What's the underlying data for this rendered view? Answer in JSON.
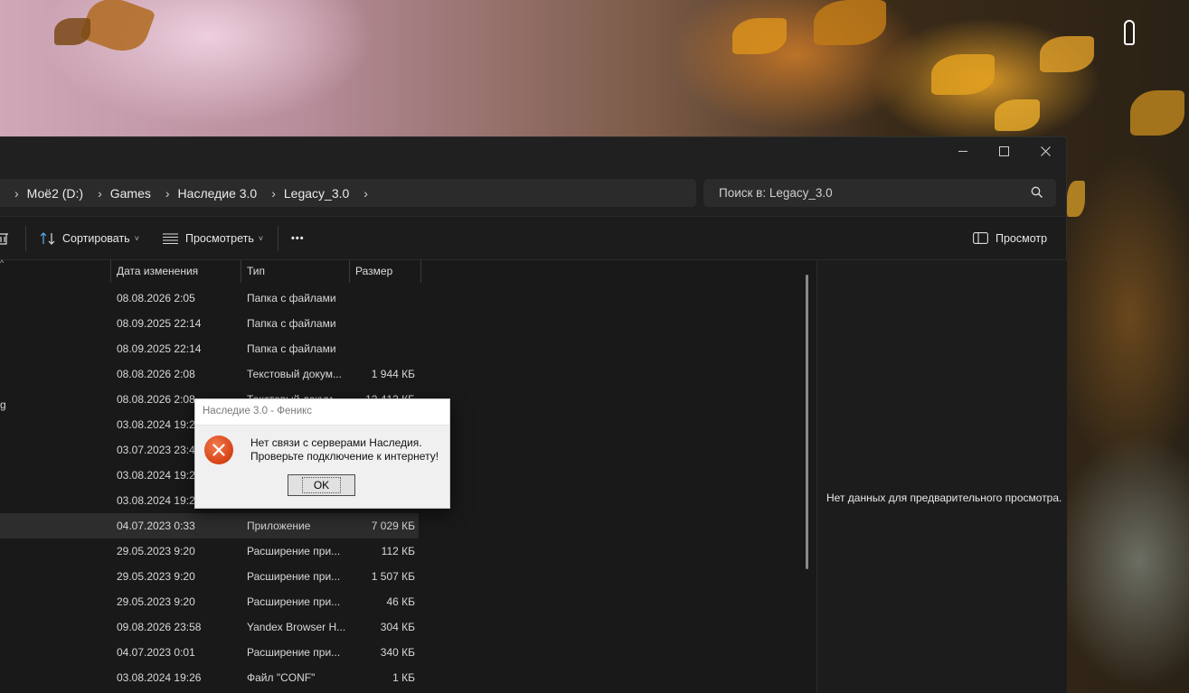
{
  "window": {
    "breadcrumbs": [
      "Моё2 (D:)",
      "Games",
      "Наследие 3.0",
      "Legacy_3.0"
    ],
    "search_placeholder": "Поиск в: Legacy_3.0"
  },
  "toolbar": {
    "sort_label": "Сортировать",
    "view_label": "Просмотреть",
    "more_label": "•••",
    "preview_label": "Просмотр"
  },
  "columns": {
    "date": "Дата изменения",
    "type": "Тип",
    "size": "Размер"
  },
  "rows": [
    {
      "date": "08.08.2026 2:05",
      "type": "Папка с файлами",
      "size": ""
    },
    {
      "date": "08.09.2025 22:14",
      "type": "Папка с файлами",
      "size": ""
    },
    {
      "date": "08.09.2025 22:14",
      "type": "Папка с файлами",
      "size": ""
    },
    {
      "date": "08.08.2026 2:08",
      "type": "Текстовый докум...",
      "size": "1 944 КБ"
    },
    {
      "date": "08.08.2026 2:08",
      "type": "Текстовый докум...",
      "size": "12 413 КБ"
    },
    {
      "date": "03.08.2024 19:26",
      "type": "",
      "size": ""
    },
    {
      "date": "03.07.2023 23:43",
      "type": "",
      "size": ""
    },
    {
      "date": "03.08.2024 19:26",
      "type": "",
      "size": ""
    },
    {
      "date": "03.08.2024 19:26",
      "type": "",
      "size": ""
    },
    {
      "date": "04.07.2023 0:33",
      "type": "Приложение",
      "size": "7 029 КБ"
    },
    {
      "date": "29.05.2023 9:20",
      "type": "Расширение при...",
      "size": "112 КБ"
    },
    {
      "date": "29.05.2023 9:20",
      "type": "Расширение при...",
      "size": "1 507 КБ"
    },
    {
      "date": "29.05.2023 9:20",
      "type": "Расширение при...",
      "size": "46 КБ"
    },
    {
      "date": "09.08.2026 23:58",
      "type": "Yandex Browser H...",
      "size": "304 КБ"
    },
    {
      "date": "04.07.2023 0:01",
      "type": "Расширение при...",
      "size": "340 КБ"
    },
    {
      "date": "03.08.2024 19:26",
      "type": "Файл \"CONF\"",
      "size": "1 КБ"
    }
  ],
  "preview": {
    "message": "Нет данных для предварительного просмотра."
  },
  "dialog": {
    "title": "Наследие 3.0 - Феникс",
    "message_line1": "Нет связи с серверами Наследия.",
    "message_line2": "Проверьте подключение к интернету!",
    "ok_label": "OK"
  },
  "colors": {
    "window_bg": "#191919",
    "error_icon": "#d64215"
  }
}
